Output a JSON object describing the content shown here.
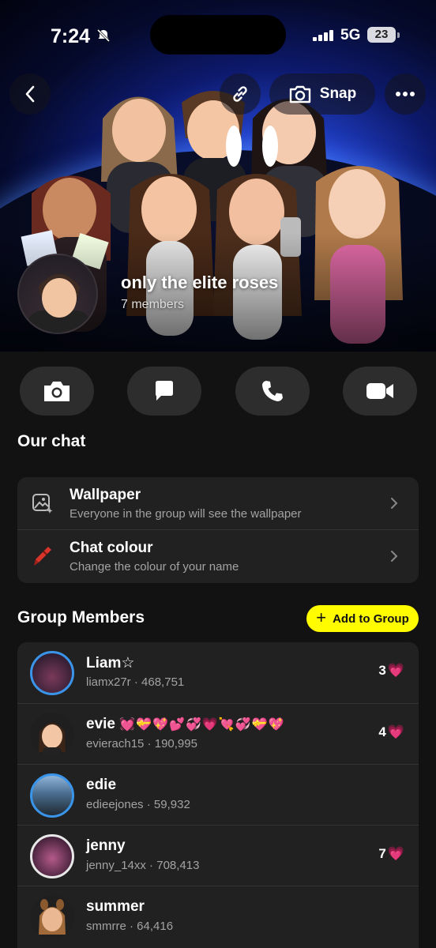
{
  "status_bar": {
    "time": "7:24",
    "network": "5G",
    "battery": "23"
  },
  "header": {
    "snap_label": "Snap",
    "group_name": "only the elite roses",
    "member_count": "7 members"
  },
  "our_chat": {
    "title": "Our chat",
    "options": [
      {
        "title": "Wallpaper",
        "subtitle": "Everyone in the group will see the wallpaper",
        "icon": "wallpaper-icon"
      },
      {
        "title": "Chat colour",
        "subtitle": "Change the colour of your name",
        "icon": "crayon-icon"
      }
    ]
  },
  "group_members": {
    "title": "Group Members",
    "add_button": "Add to Group",
    "members": [
      {
        "name": "Liam☆",
        "emojis": "",
        "username": "liamx27r",
        "score": "468,751",
        "streak": "3",
        "ring": "blue"
      },
      {
        "name": "evie",
        "emojis": "💓💝💖💕💞💗💘💞💝💖",
        "username": "evierach15",
        "score": "190,995",
        "streak": "4",
        "ring": "none"
      },
      {
        "name": "edie",
        "emojis": "",
        "username": "edieejones",
        "score": "59,932",
        "streak": "",
        "ring": "blue"
      },
      {
        "name": "jenny",
        "emojis": "",
        "username": "jenny_14xx",
        "score": "708,413",
        "streak": "7",
        "ring": "white"
      },
      {
        "name": "summer",
        "emojis": "",
        "username": "smmrre",
        "score": "64,416",
        "streak": "",
        "ring": "none"
      }
    ]
  },
  "colors": {
    "accent_yellow": "#fffc00",
    "ring_blue": "#3a95ea",
    "background": "#121212",
    "card": "#212121"
  }
}
